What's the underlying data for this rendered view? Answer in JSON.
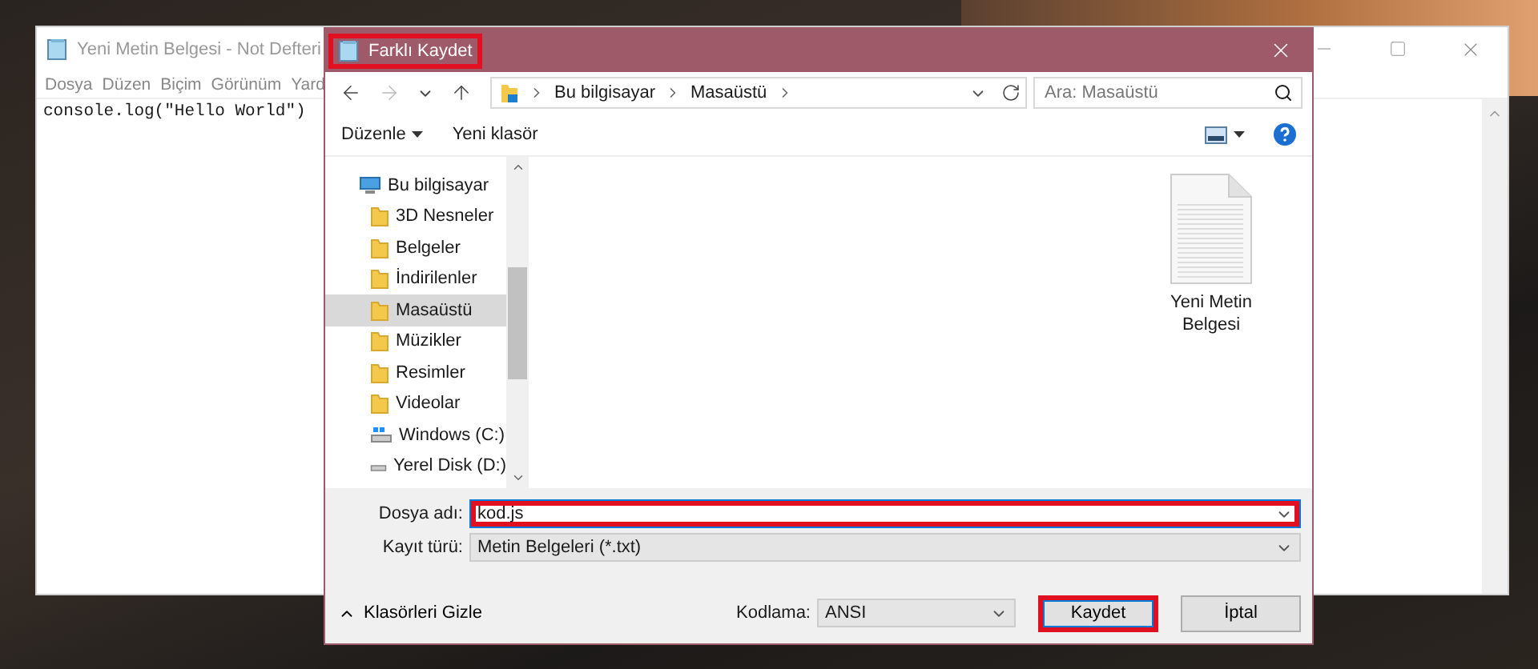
{
  "notepad": {
    "title": "Yeni Metin Belgesi - Not Defteri",
    "menu": [
      "Dosya",
      "Düzen",
      "Biçim",
      "Görünüm",
      "Yard"
    ],
    "text": "console.log(\"Hello World\")"
  },
  "dialog": {
    "title": "Farklı Kaydet",
    "title_highlighted": true,
    "breadcrumb": [
      "Bu bilgisayar",
      "Masaüstü"
    ],
    "search": {
      "placeholder": "Ara: Masaüstü"
    },
    "toolbar": {
      "organize": "Düzenle",
      "new_folder": "Yeni klasör"
    },
    "tree": [
      {
        "label": "Bu bilgisayar",
        "kind": "computer",
        "selected": false,
        "children": [
          {
            "label": "3D Nesneler",
            "kind": "folder",
            "selected": false
          },
          {
            "label": "Belgeler",
            "kind": "folder",
            "selected": false
          },
          {
            "label": "İndirilenler",
            "kind": "folder",
            "selected": false
          },
          {
            "label": "Masaüstü",
            "kind": "folder",
            "selected": true
          },
          {
            "label": "Müzikler",
            "kind": "folder",
            "selected": false
          },
          {
            "label": "Resimler",
            "kind": "folder",
            "selected": false
          },
          {
            "label": "Videolar",
            "kind": "folder",
            "selected": false
          },
          {
            "label": "Windows (C:)",
            "kind": "systemdrive",
            "selected": false
          },
          {
            "label": "Yerel Disk (D:)",
            "kind": "drive",
            "selected": false
          }
        ]
      }
    ],
    "files": [
      {
        "name": "Yeni Metin Belgesi"
      }
    ],
    "file_name": {
      "label": "Dosya adı:",
      "value": "kod.js",
      "highlighted": true
    },
    "file_type": {
      "label": "Kayıt türü:",
      "value": "Metin Belgeleri (*.txt)"
    },
    "hide_folders": "Klasörleri Gizle",
    "encoding": {
      "label": "Kodlama:",
      "value": "ANSI"
    },
    "buttons": [
      {
        "label": "Kaydet",
        "kind": "primary",
        "highlighted": true
      },
      {
        "label": "İptal",
        "kind": "secondary",
        "highlighted": false
      }
    ]
  }
}
